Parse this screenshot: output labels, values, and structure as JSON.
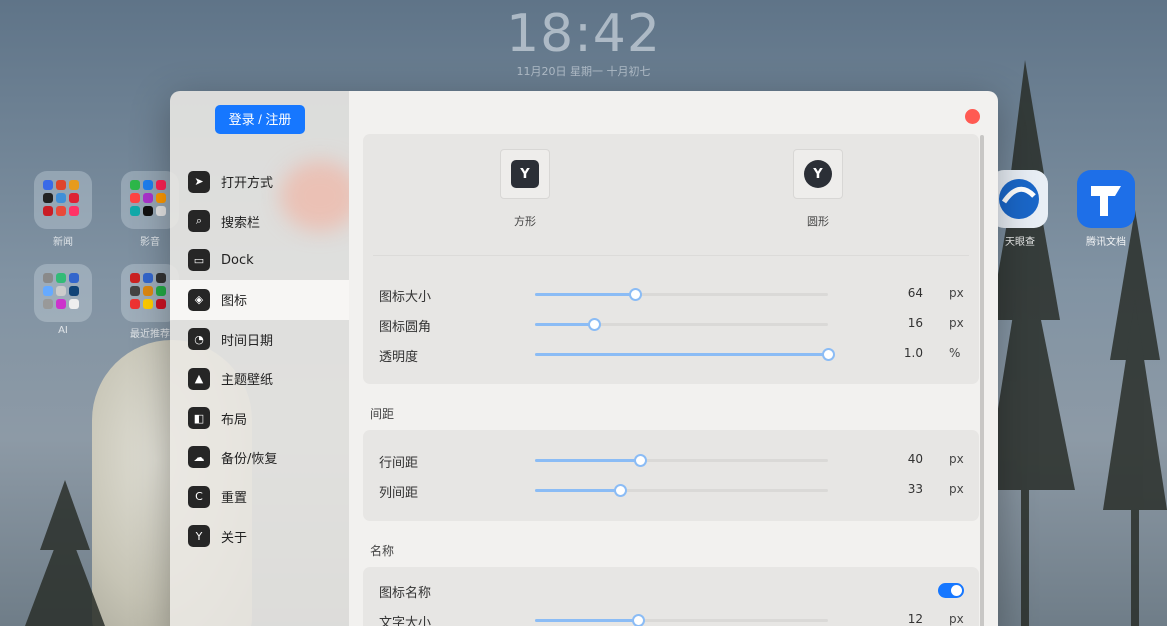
{
  "desktop": {
    "clock": "18:42",
    "date": "11月20日  星期一  十月初七",
    "folders": [
      {
        "label": "新闻"
      },
      {
        "label": "影音"
      },
      {
        "label": "AI"
      },
      {
        "label": "最近推荐"
      }
    ],
    "apps": [
      {
        "label": "天眼查",
        "icon": "tianyancha-icon",
        "color": "#1a67c9"
      },
      {
        "label": "腾讯文档",
        "icon": "tencent-docs-icon",
        "color": "#1e6fe8"
      }
    ]
  },
  "sidebar": {
    "login_label": "登录 / 注册",
    "items": [
      {
        "label": "打开方式",
        "icon": "paper-plane-icon",
        "glyph": "➤"
      },
      {
        "label": "搜索栏",
        "icon": "search-icon",
        "glyph": "⌕"
      },
      {
        "label": "Dock",
        "icon": "dock-icon",
        "glyph": "▭"
      },
      {
        "label": "图标",
        "icon": "cube-icon",
        "glyph": "◈",
        "active": true
      },
      {
        "label": "时间日期",
        "icon": "clock-icon",
        "glyph": "◔"
      },
      {
        "label": "主题壁纸",
        "icon": "image-icon",
        "glyph": "▲"
      },
      {
        "label": "布局",
        "icon": "layout-icon",
        "glyph": "◧"
      },
      {
        "label": "备份/恢复",
        "icon": "cloud-icon",
        "glyph": "☁"
      },
      {
        "label": "重置",
        "icon": "reset-icon",
        "glyph": "C"
      },
      {
        "label": "关于",
        "icon": "logo-icon",
        "glyph": "Y"
      }
    ]
  },
  "icon_settings": {
    "shapes": [
      {
        "label": "方形",
        "style": "square"
      },
      {
        "label": "圆形",
        "style": "circle"
      }
    ],
    "sliders": [
      {
        "label": "图标大小",
        "value": "64",
        "unit": "px",
        "fraction": 0.34
      },
      {
        "label": "图标圆角",
        "value": "16",
        "unit": "px",
        "fraction": 0.2
      },
      {
        "label": "透明度",
        "value": "1.0",
        "unit": "%",
        "fraction": 1.0
      }
    ]
  },
  "spacing": {
    "title": "间距",
    "sliders": [
      {
        "label": "行间距",
        "value": "40",
        "unit": "px",
        "fraction": 0.36
      },
      {
        "label": "列间距",
        "value": "33",
        "unit": "px",
        "fraction": 0.29
      }
    ]
  },
  "name": {
    "title": "名称",
    "toggle_label": "图标名称",
    "toggle_on": true,
    "font_size_label": "文字大小",
    "font_size_value": "12",
    "font_size_unit": "px",
    "font_size_fraction": 0.35
  },
  "colors": {
    "accent": "#1677ff",
    "slider": "#8bbcf5",
    "close": "#ff5a52"
  }
}
